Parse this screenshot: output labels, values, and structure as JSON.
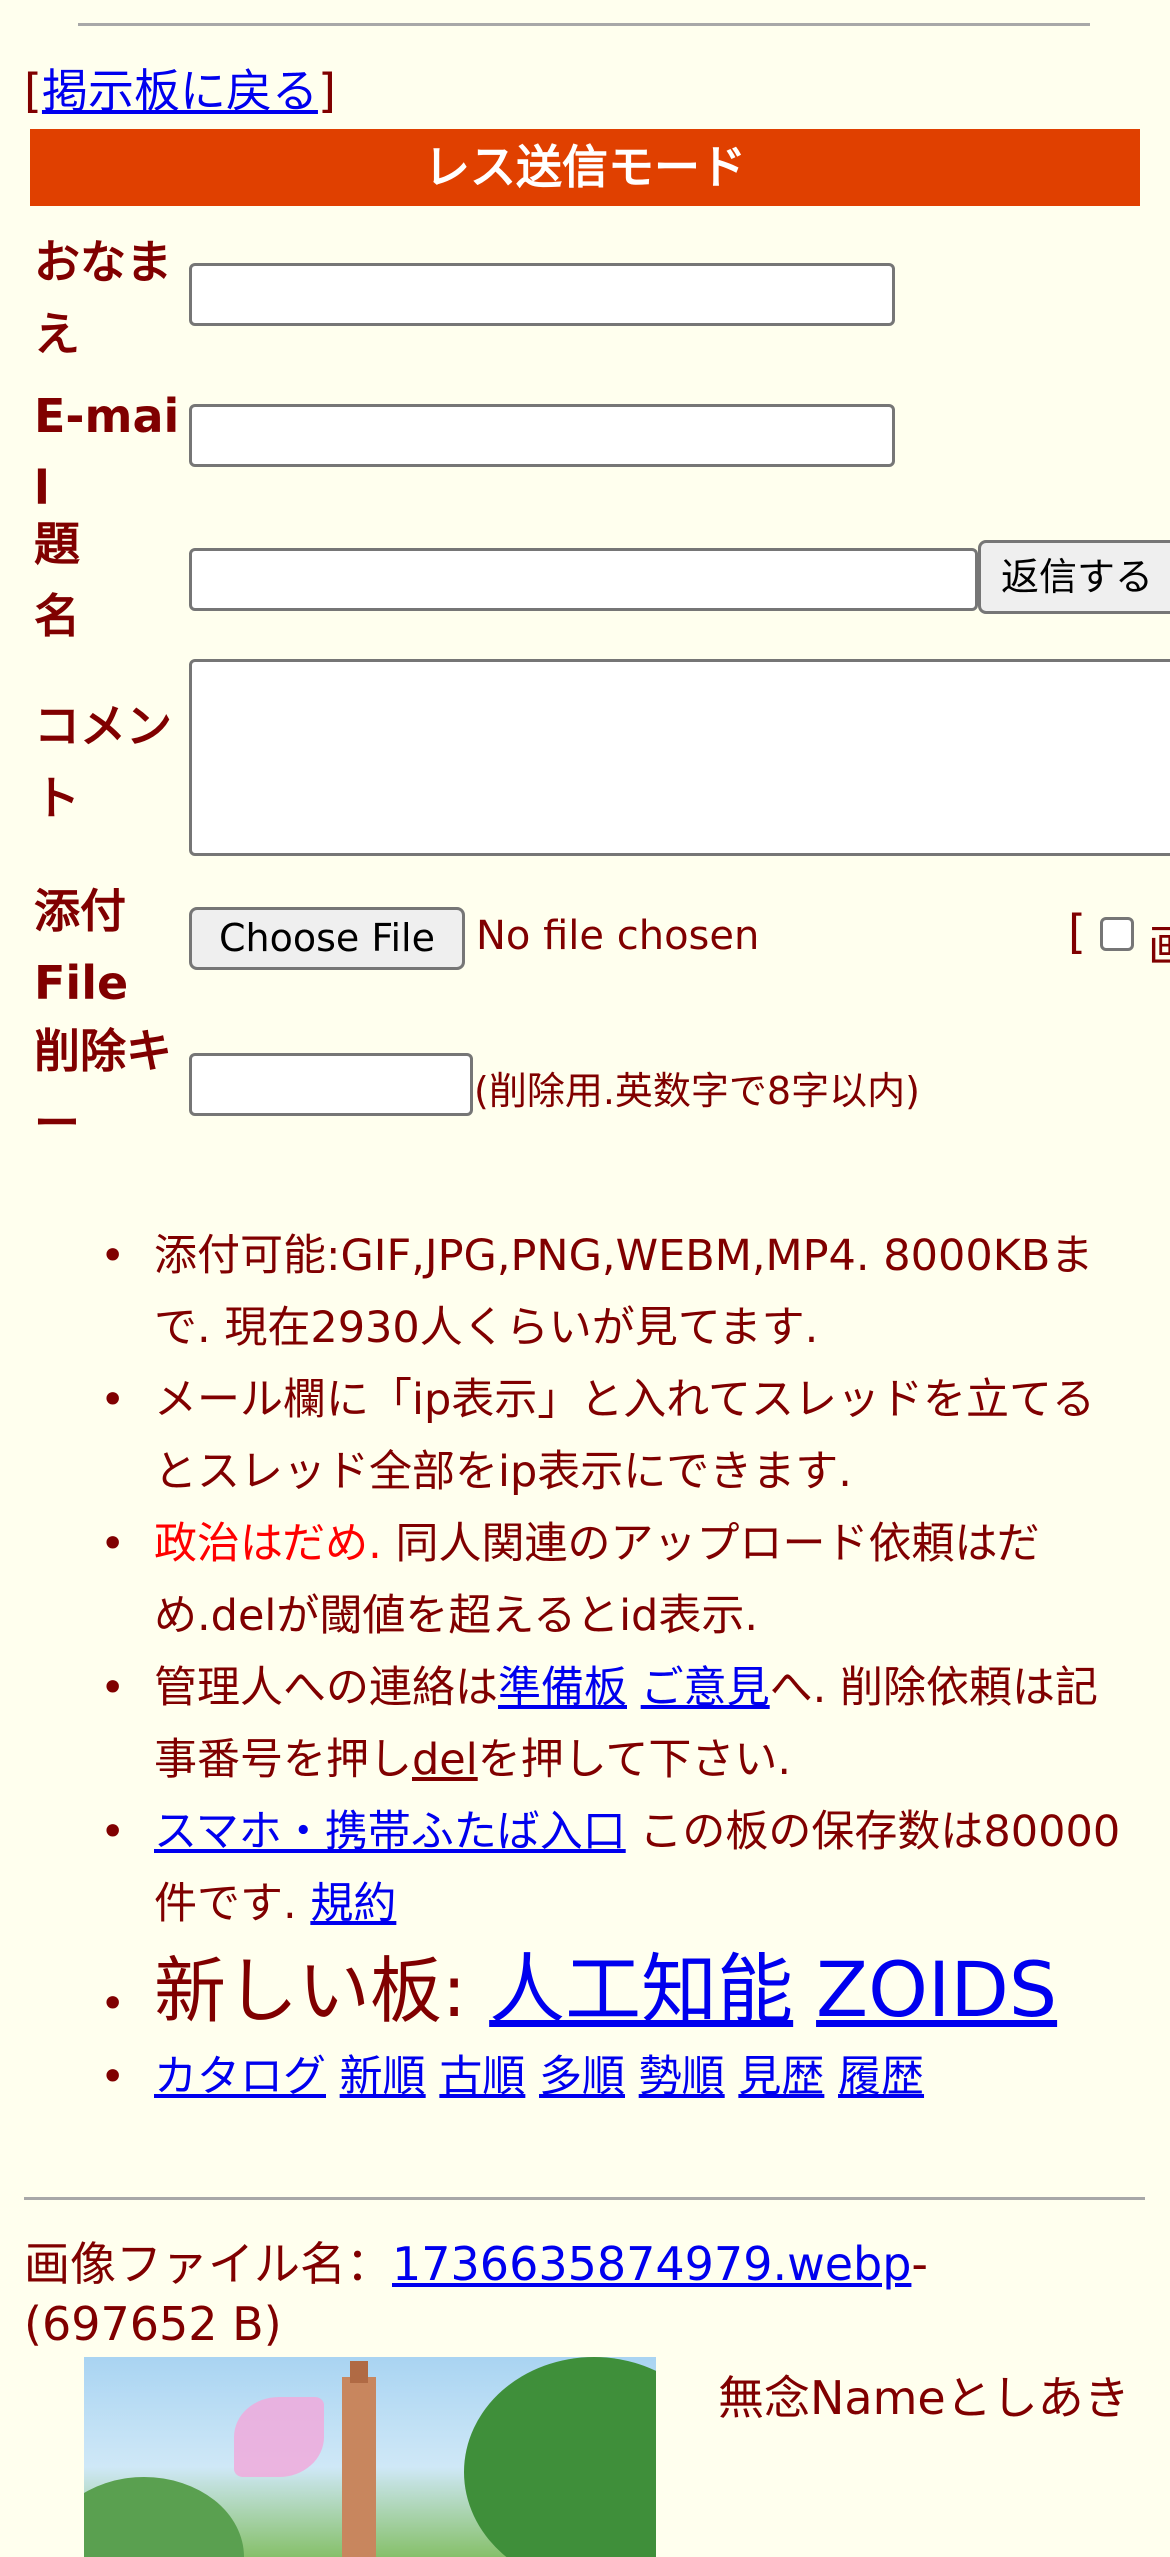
{
  "back_link": {
    "open": "[",
    "label": "掲示板に戻る",
    "close": "]"
  },
  "mode_title": "レス送信モード",
  "form": {
    "name_label": "おなまえ",
    "email_label": "E-mail",
    "subject_label": "題名",
    "comment_label": "コメント",
    "file_label": "添付File",
    "delkey_label": "削除キー",
    "submit_label": "返信する",
    "choose_file_label": "Choose File",
    "no_file_text": "No file chosen",
    "image_option_bracket": "[",
    "image_option_char": "画",
    "delkey_note": "(削除用.英数字で8字以内)",
    "name_value": "",
    "email_value": "",
    "subject_value": "",
    "comment_value": "",
    "delkey_value": ""
  },
  "rules": {
    "r1": "添付可能:GIF,JPG,PNG,WEBM,MP4. 8000KBまで. 現在2930人くらいが見てます.",
    "r2": "メール欄に「ip表示」と入れてスレッドを立てるとスレッド全部をip表示にできます.",
    "r3_red": "政治はだめ.",
    "r3_rest": " 同人関連のアップロード依頼はだめ.delが閾値を超えるとid表示.",
    "r4_a": "管理人への連絡は",
    "r4_link1": "準備板",
    "r4_link2": "ご意見",
    "r4_b": "へ. 削除依頼は記事番号を押し",
    "r4_link3": "del",
    "r4_c": "を押して下さい.",
    "r5_link": "スマホ・携帯ふたば入口",
    "r5_text": " この板の保存数は80000件です. ",
    "r5_link2": "規約",
    "r6_text": "新しい板: ",
    "r6_link1": "人工知能",
    "r6_link2": "ZOIDS",
    "nav": [
      "カタログ",
      "新順",
      "古順",
      "多順",
      "勢順",
      "見歴",
      "履歴"
    ]
  },
  "post": {
    "file_label": "画像ファイル名：",
    "file_name": "1736635874979.webp",
    "file_dash": "-",
    "file_size": "(697652 B)",
    "name_text": "無念Nameとしあき"
  },
  "colors": {
    "accent": "#e04000",
    "background": "#ffffee",
    "text": "#800000",
    "link": "#0000ee"
  }
}
